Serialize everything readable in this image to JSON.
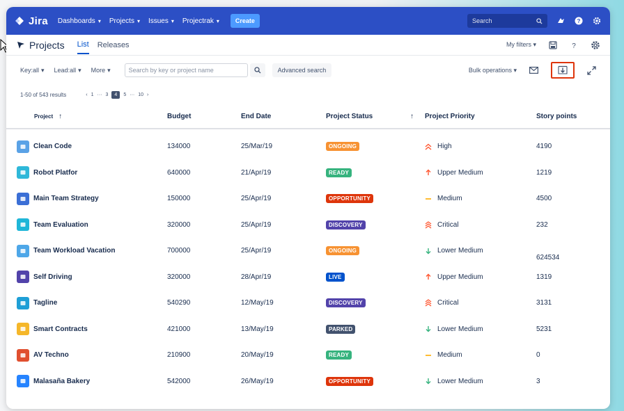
{
  "topbar": {
    "logo_text": "Jira",
    "nav": [
      {
        "label": "Dashboards"
      },
      {
        "label": "Projects"
      },
      {
        "label": "Issues"
      },
      {
        "label": "Projectrak"
      }
    ],
    "create_label": "Create",
    "search_placeholder": "Search"
  },
  "subnav": {
    "title": "Projects",
    "tabs": [
      {
        "label": "List"
      },
      {
        "label": "Releases"
      }
    ],
    "my_filters": "My filters"
  },
  "filters": {
    "key": "Key:all",
    "lead": "Lead:all",
    "more": "More",
    "search_placeholder": "Search by key or project name",
    "advanced": "Advanced search",
    "bulk": "Bulk operations"
  },
  "results": {
    "summary": "1-50 of 543 results",
    "pages": [
      "1",
      "···",
      "3",
      "4",
      "5",
      "···",
      "10"
    ],
    "current_page": "4"
  },
  "table": {
    "headers": {
      "project": "Project",
      "budget": "Budget",
      "end_date": "End Date",
      "status": "Project Status",
      "priority": "Project Priority",
      "points": "Story points"
    },
    "rows": [
      {
        "name": "Clean Code",
        "budget": "134000",
        "end": "25/Mar/19",
        "status": "ONGOING",
        "priority": "High",
        "points": "4190",
        "avatar": "#5aa2e6",
        "prio_icon": "double-chevron-up"
      },
      {
        "name": "Robot Platfor",
        "budget": "640000",
        "end": "21/Apr/19",
        "status": "READY",
        "priority": "Upper Medium",
        "points": "1219",
        "avatar": "#2fb8d9",
        "prio_icon": "arrow-up"
      },
      {
        "name": "Main Team Strategy",
        "budget": "150000",
        "end": "25/Apr/19",
        "status": "OPPORTUNITY",
        "priority": "Medium",
        "points": "4500",
        "avatar": "#3b6fd6",
        "prio_icon": "dash"
      },
      {
        "name": "Team Evaluation",
        "budget": "320000",
        "end": "25/Apr/19",
        "status": "DISCOVERY",
        "priority": "Critical",
        "points": "232",
        "avatar": "#1fb6d8",
        "prio_icon": "triple-chevron-up"
      },
      {
        "name": "Team Workload Vacation",
        "budget": "700000",
        "end": "25/Apr/19",
        "status": "ONGOING",
        "priority": "Lower Medium",
        "points": "624534",
        "avatar": "#4ea7e8",
        "prio_icon": "arrow-down"
      },
      {
        "name": "Self Driving",
        "budget": "320000",
        "end": "28/Apr/19",
        "status": "LIVE",
        "priority": "Upper Medium",
        "points": "1319",
        "avatar": "#5243aa",
        "prio_icon": "arrow-up"
      },
      {
        "name": "Tagline",
        "budget": "540290",
        "end": "12/May/19",
        "status": "DISCOVERY",
        "priority": "Critical",
        "points": "3131",
        "avatar": "#1f9fd6",
        "prio_icon": "triple-chevron-up"
      },
      {
        "name": "Smart Contracts",
        "budget": "421000",
        "end": "13/May/19",
        "status": "PARKED",
        "priority": "Lower Medium",
        "points": "5231",
        "avatar": "#f5b72a",
        "prio_icon": "arrow-down"
      },
      {
        "name": "AV Techno",
        "budget": "210900",
        "end": "20/May/19",
        "status": "READY",
        "priority": "Medium",
        "points": "0",
        "avatar": "#e04f2f",
        "prio_icon": "dash"
      },
      {
        "name": "Malasaña Bakery",
        "budget": "542000",
        "end": "26/May/19",
        "status": "OPPORTUNITY",
        "priority": "Lower Medium",
        "points": "3",
        "avatar": "#2684ff",
        "prio_icon": "arrow-down"
      }
    ]
  },
  "colors": {
    "topbar": "#2c4fc5",
    "ONGOING": "#f79232",
    "READY": "#36b37e",
    "OPPORTUNITY": "#de350b",
    "DISCOVERY": "#5243aa",
    "LIVE": "#0052cc",
    "PARKED": "#42526e",
    "prio_up": "#ff5630",
    "prio_medium": "#ffab00",
    "prio_down": "#36b37e"
  }
}
